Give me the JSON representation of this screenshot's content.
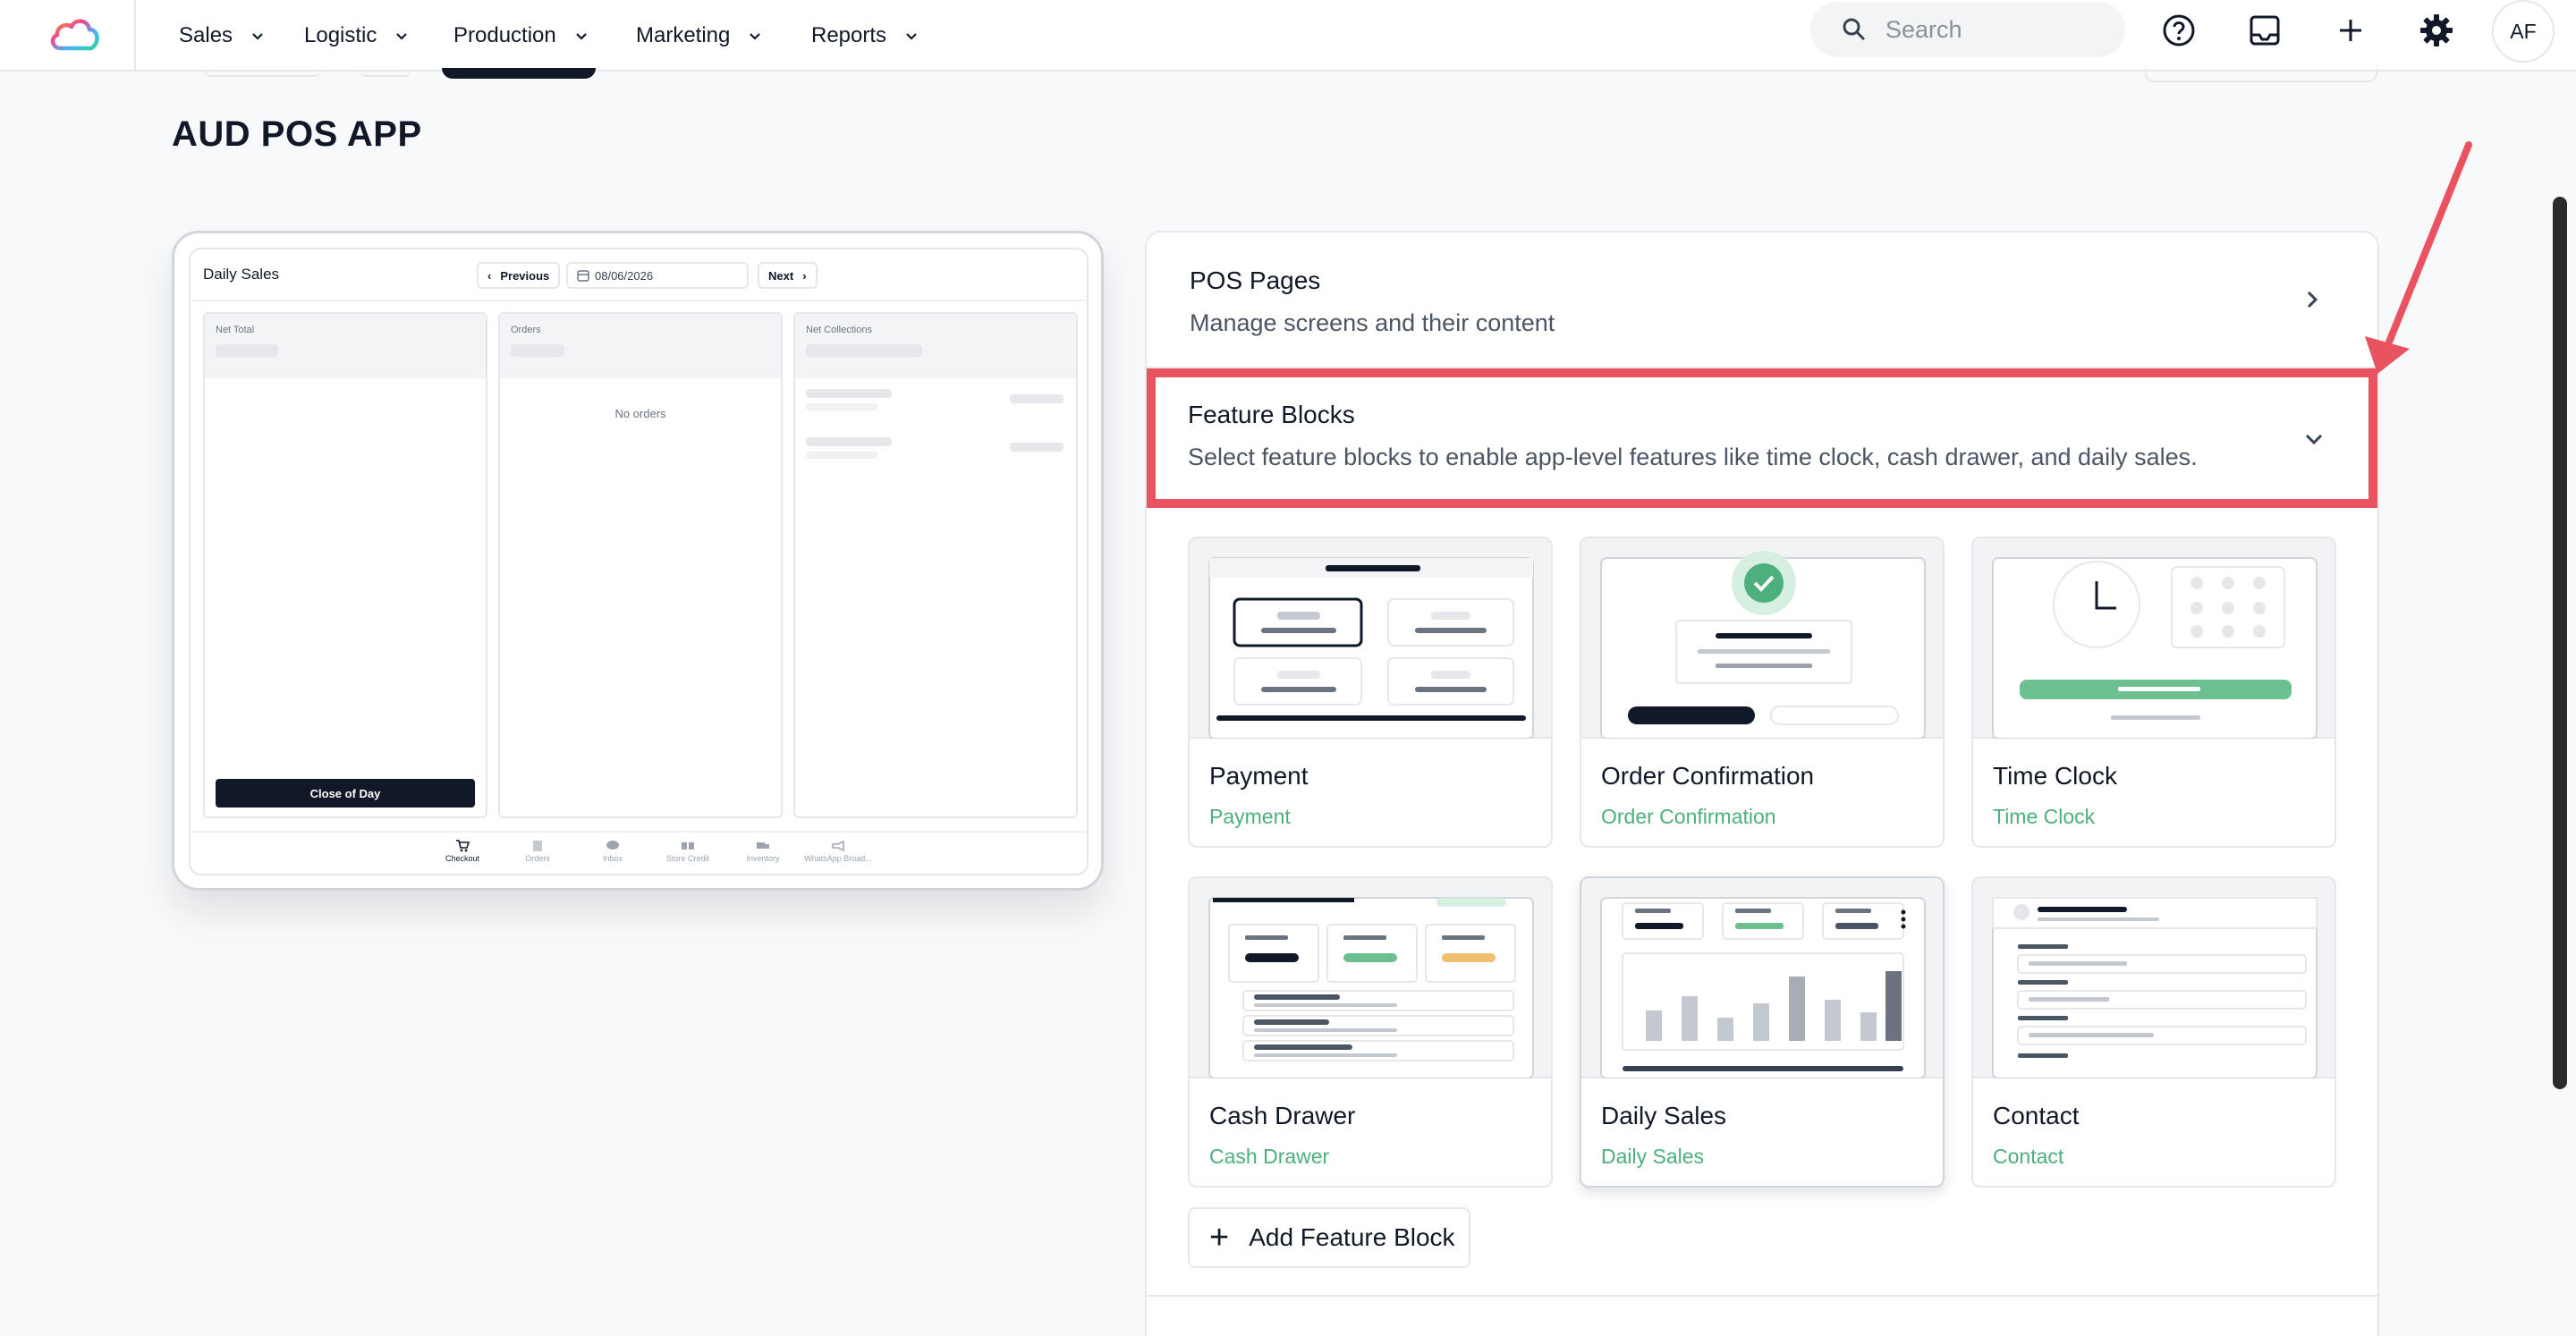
{
  "nav": {
    "items": [
      {
        "label": "Sales"
      },
      {
        "label": "Logistic"
      },
      {
        "label": "Production"
      },
      {
        "label": "Marketing"
      },
      {
        "label": "Reports"
      }
    ],
    "search_placeholder": "Search",
    "avatar_initials": "AF",
    "icons": [
      "help-icon",
      "inbox-icon",
      "plus-icon",
      "gear-icon"
    ]
  },
  "page": {
    "title": "AUD POS APP"
  },
  "preview": {
    "title": "Daily Sales",
    "prev_label": "Previous",
    "date": "08/06/2026",
    "next_label": "Next",
    "columns": [
      {
        "label": "Net Total"
      },
      {
        "label": "Orders",
        "empty_text": "No orders"
      },
      {
        "label": "Net Collections"
      }
    ],
    "close_day_label": "Close of Day",
    "tabs": [
      {
        "label": "Checkout"
      },
      {
        "label": "Orders"
      },
      {
        "label": "Inbox"
      },
      {
        "label": "Store Credit"
      },
      {
        "label": "Inventory"
      },
      {
        "label": "WhatsApp Broad..."
      }
    ]
  },
  "panel": {
    "pos_pages": {
      "title": "POS Pages",
      "subtitle": "Manage screens and their content"
    },
    "feature_blocks": {
      "title": "Feature Blocks",
      "subtitle": "Select feature blocks to enable app-level features like time clock, cash drawer, and daily sales."
    },
    "cards": [
      {
        "name": "Payment",
        "tag": "Payment"
      },
      {
        "name": "Order Confirmation",
        "tag": "Order Confirmation"
      },
      {
        "name": "Time Clock",
        "tag": "Time Clock"
      },
      {
        "name": "Cash Drawer",
        "tag": "Cash Drawer"
      },
      {
        "name": "Daily Sales",
        "tag": "Daily Sales"
      },
      {
        "name": "Contact",
        "tag": "Contact"
      }
    ],
    "add_label": "Add Feature Block"
  },
  "colors": {
    "highlight": "#e8535f",
    "accent_green": "#4caf7d",
    "dark": "#111827"
  }
}
